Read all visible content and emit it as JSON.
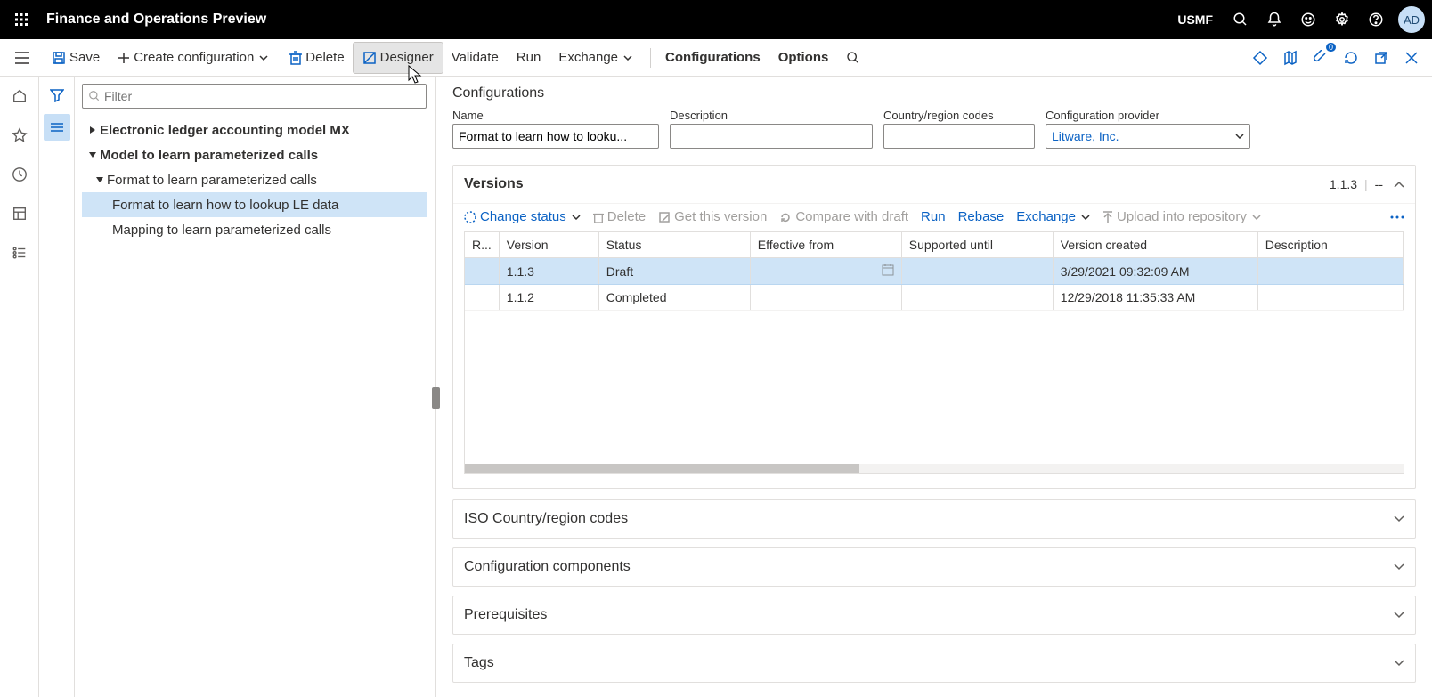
{
  "topbar": {
    "title": "Finance and Operations Preview",
    "env": "USMF",
    "avatar": "AD"
  },
  "toolbar": {
    "save": "Save",
    "create": "Create configuration",
    "delete": "Delete",
    "designer": "Designer",
    "validate": "Validate",
    "run": "Run",
    "exchange": "Exchange",
    "configurations": "Configurations",
    "options": "Options",
    "badge": "0"
  },
  "filter": {
    "placeholder": "Filter"
  },
  "tree": {
    "n0": "Electronic ledger accounting model MX",
    "n1": "Model to learn parameterized calls",
    "n2": "Format to learn parameterized calls",
    "n3": "Format to learn how to lookup LE data",
    "n4": "Mapping to learn parameterized calls"
  },
  "crumb": "Configurations",
  "fields": {
    "name_label": "Name",
    "name_value": "Format to learn how to looku...",
    "desc_label": "Description",
    "desc_value": "",
    "country_label": "Country/region codes",
    "country_value": "",
    "provider_label": "Configuration provider",
    "provider_value": "Litware, Inc."
  },
  "versions": {
    "title": "Versions",
    "current": "1.1.3",
    "dashes": "--",
    "change_status": "Change status",
    "delete": "Delete",
    "get": "Get this version",
    "compare": "Compare with draft",
    "run": "Run",
    "rebase": "Rebase",
    "exchange": "Exchange",
    "upload": "Upload into repository",
    "cols": {
      "r": "R...",
      "version": "Version",
      "status": "Status",
      "eff": "Effective from",
      "sup": "Supported until",
      "created": "Version created",
      "desc": "Description"
    },
    "rows": [
      {
        "version": "1.1.3",
        "status": "Draft",
        "eff": "",
        "sup": "",
        "created": "3/29/2021 09:32:09 AM",
        "desc": ""
      },
      {
        "version": "1.1.2",
        "status": "Completed",
        "eff": "",
        "sup": "",
        "created": "12/29/2018 11:35:33 AM",
        "desc": ""
      }
    ]
  },
  "sections": {
    "iso": "ISO Country/region codes",
    "components": "Configuration components",
    "prereq": "Prerequisites",
    "tags": "Tags"
  }
}
